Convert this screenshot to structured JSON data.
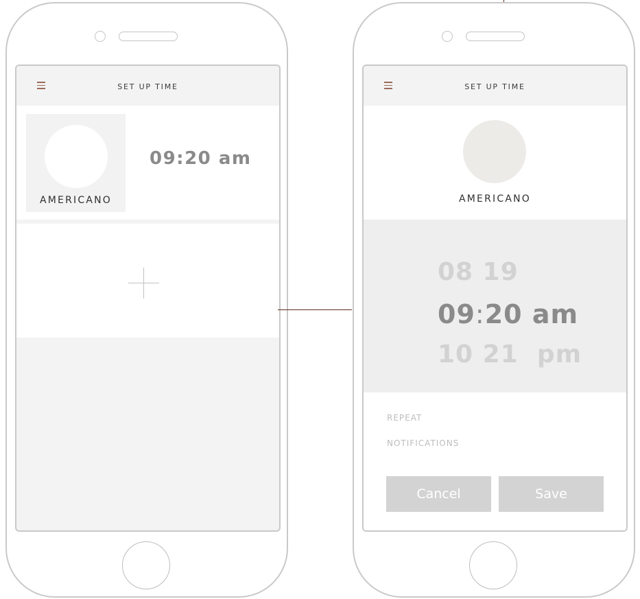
{
  "colors": {
    "frame_stroke": "#c9c9c9",
    "screen_bg": "#f3f3f3",
    "menu_icon": "#9a6a5a",
    "connector": "#5a2e1a",
    "button_bg": "#d3d3d3",
    "picker_bg": "#eeeeee"
  },
  "left_screen": {
    "title": "SET UP TIME",
    "menu_icon": "menu-icon",
    "alarm": {
      "drink": "AMERICANO",
      "time": "09:20 am"
    },
    "add_icon": "plus-icon"
  },
  "right_screen": {
    "title": "SET UP TIME",
    "menu_icon": "menu-icon",
    "drink": "AMERICANO",
    "picker": {
      "rows": [
        {
          "hour": "08",
          "minute": "19",
          "period": ""
        },
        {
          "hour": "09",
          "minute": "20",
          "period": "am",
          "selected": true
        },
        {
          "hour": "10",
          "minute": "21",
          "period": "pm"
        }
      ]
    },
    "options": [
      "REPEAT",
      "NOTIFICATIONS"
    ],
    "buttons": {
      "cancel": "Cancel",
      "save": "Save"
    }
  }
}
